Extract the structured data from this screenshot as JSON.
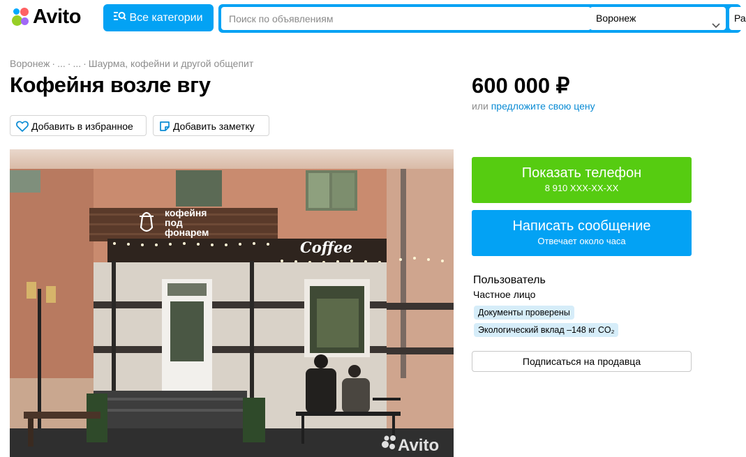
{
  "header": {
    "logo_text": "Avito",
    "logo_colors": [
      "#97cf26",
      "#a169f7",
      "#0af",
      "#ff6163"
    ],
    "categories_button": "Все категории",
    "search_placeholder": "Поиск по объявлениям",
    "city": "Воронеж",
    "radius_label": "Ра",
    "accent_color": "#03a2f4"
  },
  "breadcrumb": {
    "items": [
      "Воронеж",
      "...",
      "...",
      "Шаурма, кофейни и другой общепит"
    ],
    "separator": "·"
  },
  "listing": {
    "title": "Кофейня возле вгу",
    "favorite_button": "Добавить в избранное",
    "note_button": "Добавить заметку",
    "photo": {
      "sign_line1": "кофейня",
      "sign_line2": "под",
      "sign_line3": "фонарем",
      "coffee_sign": "Coffee",
      "watermark": "Avito"
    }
  },
  "price": {
    "value": "600 000 ₽",
    "hint_prefix": "или ",
    "hint_link": "предложите свою цену"
  },
  "contact": {
    "phone_button": "Показать телефон",
    "phone_masked": "8 910 XXX-XX-XX",
    "message_button": "Написать сообщение",
    "message_sub": "Отвечает около часа",
    "phone_color": "#56cc11"
  },
  "seller": {
    "name": "Пользователь",
    "type": "Частное лицо",
    "badges": [
      "Документы проверены",
      "Экологический вклад –148 кг CO₂"
    ],
    "subscribe_button": "Подписаться на продавца"
  }
}
